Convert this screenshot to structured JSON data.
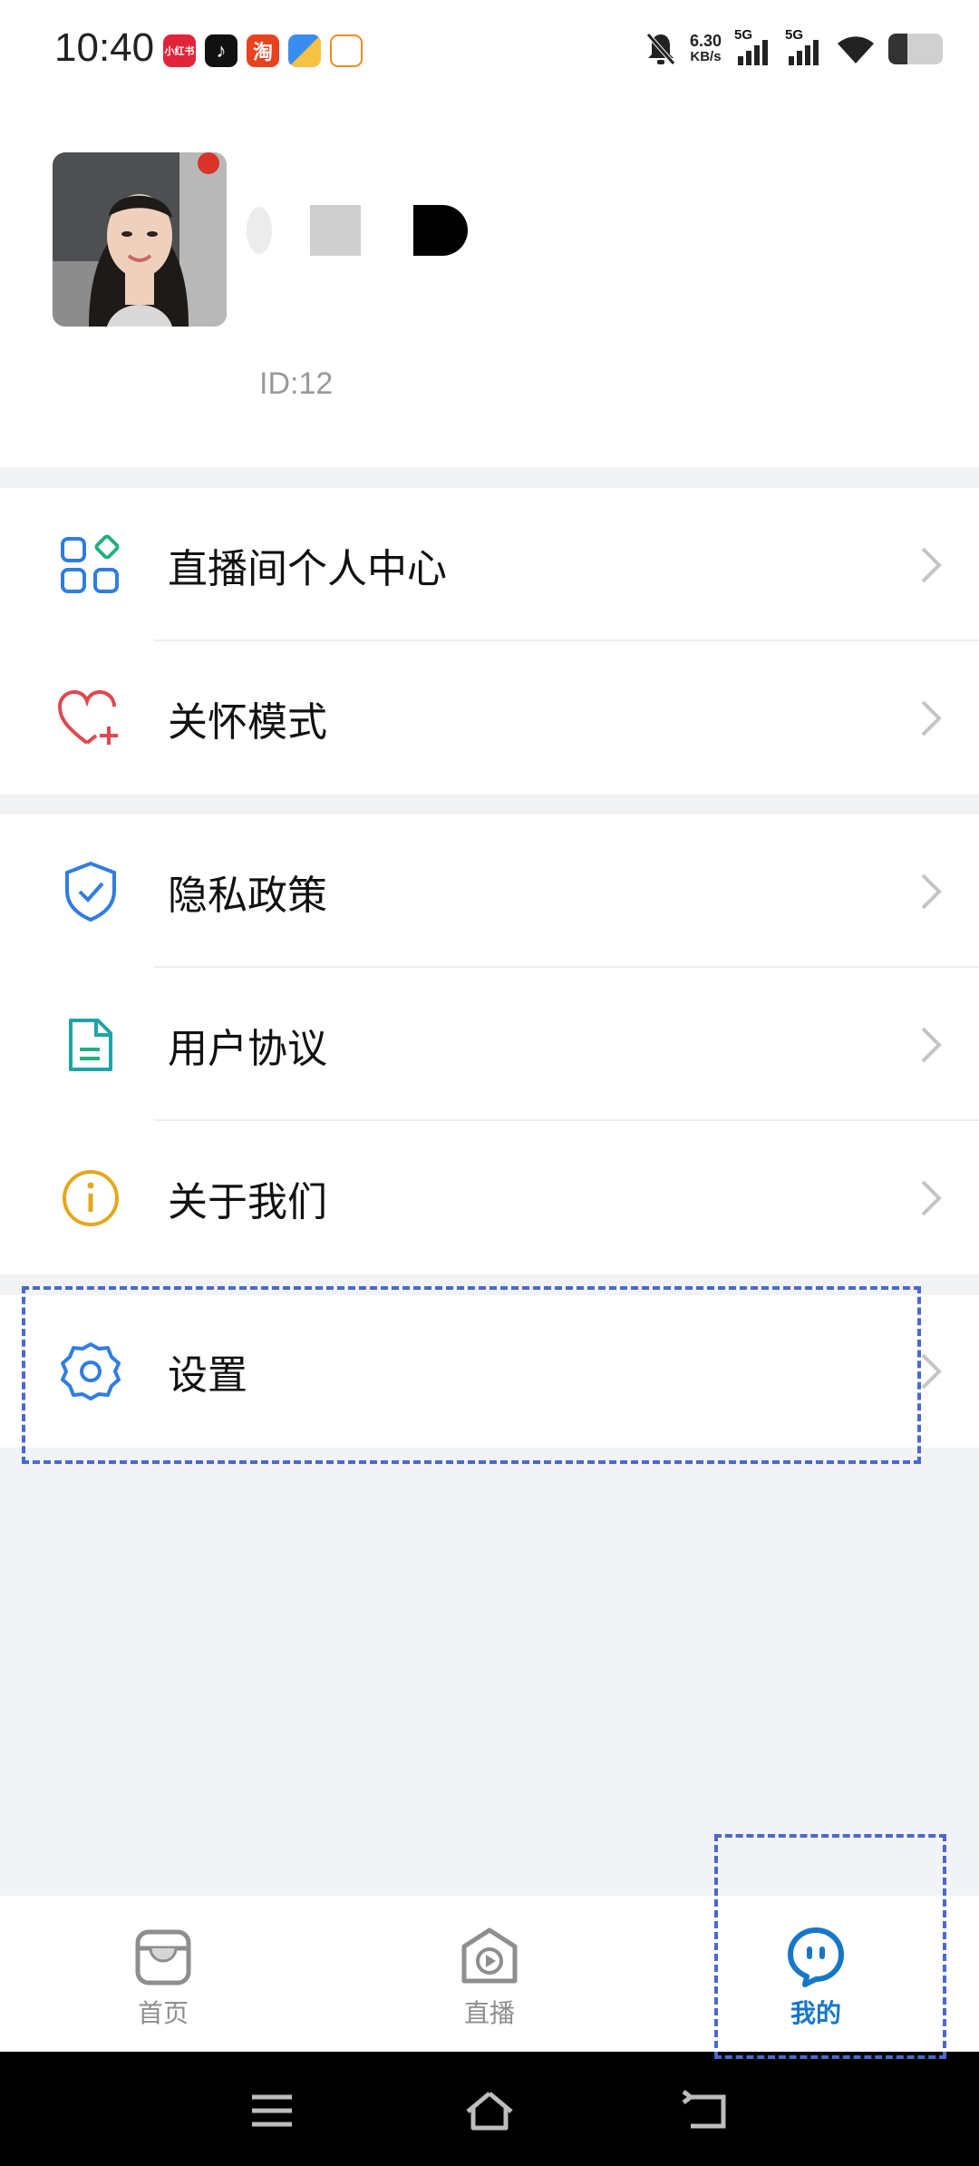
{
  "status_bar": {
    "time": "10:40",
    "notification_apps": [
      {
        "icon": "xiaohongshu-app-icon",
        "label": "小红书",
        "color": "#e2243b"
      },
      {
        "icon": "douyin-app-icon",
        "label": "♪",
        "color": "#111111"
      },
      {
        "icon": "taobao-app-icon",
        "label": "淘",
        "color": "#e8421f"
      },
      {
        "icon": "files-app-icon",
        "label": "",
        "color": "#3a8df0"
      },
      {
        "icon": "chat-app-icon",
        "label": "",
        "color": "#f0f0f0"
      }
    ],
    "net_speed_value": "6.30",
    "net_speed_unit": "KB/s",
    "signal_1_label": "5G",
    "signal_2_label": "5G",
    "battery_level": 0.35
  },
  "profile": {
    "user_id": "ID:12"
  },
  "menu": {
    "group1": [
      {
        "label": "直播间个人中心",
        "icon": "apps-grid-icon"
      },
      {
        "label": "关怀模式",
        "icon": "heart-plus-icon"
      }
    ],
    "group2": [
      {
        "label": "隐私政策",
        "icon": "shield-check-icon"
      },
      {
        "label": "用户协议",
        "icon": "document-icon"
      },
      {
        "label": "关于我们",
        "icon": "info-icon"
      }
    ],
    "group3": [
      {
        "label": "设置",
        "icon": "gear-icon"
      }
    ]
  },
  "bottom_nav": {
    "items": [
      {
        "label": "首页",
        "icon": "home-icon",
        "active": false
      },
      {
        "label": "直播",
        "icon": "live-play-icon",
        "active": false
      },
      {
        "label": "我的",
        "icon": "chat-bubble-icon",
        "active": true
      }
    ],
    "active_color": "#1677c8",
    "inactive_color": "#8e8e8e"
  },
  "system_nav": {
    "buttons": [
      "menu-icon",
      "home-outline-icon",
      "back-icon"
    ]
  }
}
